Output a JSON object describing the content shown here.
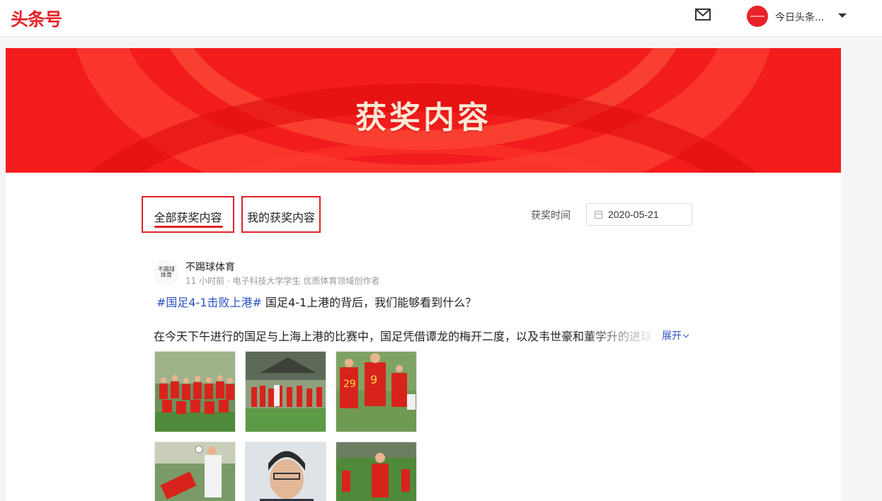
{
  "header": {
    "logo": "头条号",
    "account_name": "今日头条...",
    "icons": {
      "mail": "mail-icon",
      "dropdown": "chevron-down-icon"
    }
  },
  "banner": {
    "title": "获奖内容"
  },
  "tabs": [
    {
      "label": "全部获奖内容",
      "active": true
    },
    {
      "label": "我的获奖内容",
      "active": false
    }
  ],
  "filter": {
    "label": "获奖时间",
    "date": "2020-05-21"
  },
  "post": {
    "author": "不踢球体育",
    "meta": "11 小时前 · 电子科技大学学生 优质体育领域创作者",
    "hashtag": "#国足4-1击败上港#",
    "headline": " 国足4-1上港的背后，我们能够看到什么？",
    "body": "在今天下午进行的国足与上海上港的比赛中，国足凭借谭龙的梅开二度，以及韦世豪和董学升的进球",
    "expand_label": "展开"
  },
  "colors": {
    "brand": "#e8222a",
    "banner": "#f21c1c",
    "link": "#2b53c4"
  }
}
